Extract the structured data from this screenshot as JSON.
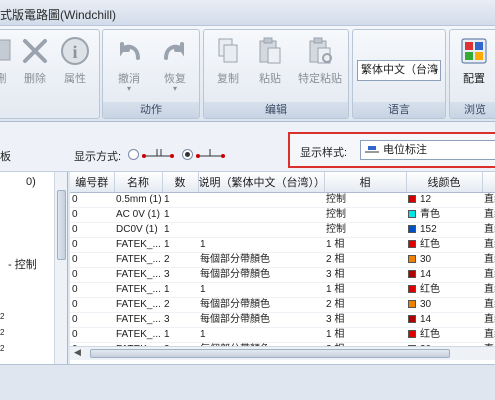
{
  "window": {
    "title": "式版電路圖(Windchill)"
  },
  "ribbon": {
    "groups": {
      "action": "动作",
      "edit": "编辑",
      "language": "语言",
      "browse": "浏览"
    },
    "buttons": {
      "delete_partial": "删",
      "delete": "删除",
      "properties": "属性",
      "undo": "撤消",
      "redo": "恢复",
      "copy": "复制",
      "paste": "粘贴",
      "paste_special": "特定粘贴",
      "config": "配置"
    },
    "language_select": "繁体中文（台湾",
    "language_arrow": "▾"
  },
  "toolbar": {
    "left_partial": "板",
    "display_mode_label": "显示方式:",
    "display_style_label": "显示样式:",
    "display_style_value": "电位标注"
  },
  "tree": {
    "items": [
      "0)",
      "- 控制",
      "2",
      "2",
      "2"
    ]
  },
  "grid": {
    "columns": [
      "编号群",
      "名称",
      "数",
      "说明（繁体中文（台湾））",
      "相",
      "线颜色",
      ""
    ],
    "rows": [
      {
        "group": "0",
        "name": "0.5mm (1)",
        "count": "1",
        "desc": "",
        "phase": "控制",
        "color_hex": "#d90000",
        "color": "12",
        "extra": "直线"
      },
      {
        "group": "0",
        "name": "AC 0V (1)",
        "count": "1",
        "desc": "",
        "phase": "控制",
        "color_hex": "#00e5e5",
        "color": "青色",
        "extra": "直线"
      },
      {
        "group": "0",
        "name": "DC0V (1)",
        "count": "1",
        "desc": "",
        "phase": "控制",
        "color_hex": "#0050c8",
        "color": "152",
        "extra": "直线"
      },
      {
        "group": "0",
        "name": "FATEK_...",
        "count": "1",
        "desc": "1",
        "phase": "1 相",
        "color_hex": "#e00000",
        "color": "红色",
        "extra": "直线"
      },
      {
        "group": "0",
        "name": "FATEK_...",
        "count": "2",
        "desc": "每個部分帶顏色",
        "phase": "2 相",
        "color_hex": "#f08000",
        "color": "30",
        "extra": "直线"
      },
      {
        "group": "0",
        "name": "FATEK_...",
        "count": "3",
        "desc": "每個部分帶顏色",
        "phase": "3 相",
        "color_hex": "#b00000",
        "color": "14",
        "extra": "直线"
      },
      {
        "group": "0",
        "name": "FATEK_...",
        "count": "1",
        "desc": "1",
        "phase": "1 相",
        "color_hex": "#e00000",
        "color": "红色",
        "extra": "直线"
      },
      {
        "group": "0",
        "name": "FATEK_...",
        "count": "2",
        "desc": "每個部分帶顏色",
        "phase": "2 相",
        "color_hex": "#f08000",
        "color": "30",
        "extra": "直线"
      },
      {
        "group": "0",
        "name": "FATEK_...",
        "count": "3",
        "desc": "每個部分帶顏色",
        "phase": "3 相",
        "color_hex": "#b00000",
        "color": "14",
        "extra": "直线"
      },
      {
        "group": "0",
        "name": "FATEK_...",
        "count": "1",
        "desc": "1",
        "phase": "1 相",
        "color_hex": "#e00000",
        "color": "红色",
        "extra": "直线"
      },
      {
        "group": "0",
        "name": "FATEK_...",
        "count": "2",
        "desc": "每個部分帶顏色",
        "phase": "2 相",
        "color_hex": "#f08000",
        "color": "30",
        "extra": "直线"
      }
    ]
  },
  "scroll": {
    "left_arrow": "◀"
  },
  "colors": {
    "highlight_border": "#d9302c",
    "ribbon_bg": "#e3e9f1"
  }
}
